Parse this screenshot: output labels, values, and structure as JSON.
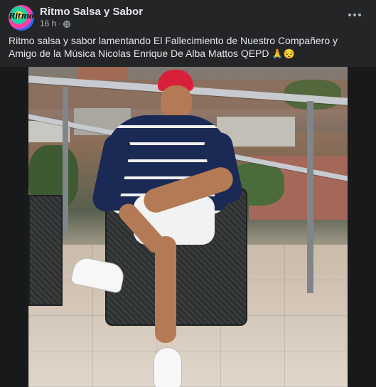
{
  "post": {
    "page_name": "Ritmo Salsa y Sabor",
    "avatar_text": "Ritmo",
    "time": "16 h",
    "separator": "·",
    "privacy_icon": "globe-icon",
    "menu_icon": "more-horizontal-icon",
    "caption_text": "Ritmo salsa y sabor lamentando El Fallecimiento de Nuestro Compañero y Amigo de la Música Nicolas Enrique De Alba Mattos QEPD",
    "caption_emoji": "🙏😔"
  },
  "colors": {
    "background": "#242526",
    "text": "#e4e6eb",
    "secondary_text": "#b0b3b8",
    "photo_frame": "#18191a"
  }
}
